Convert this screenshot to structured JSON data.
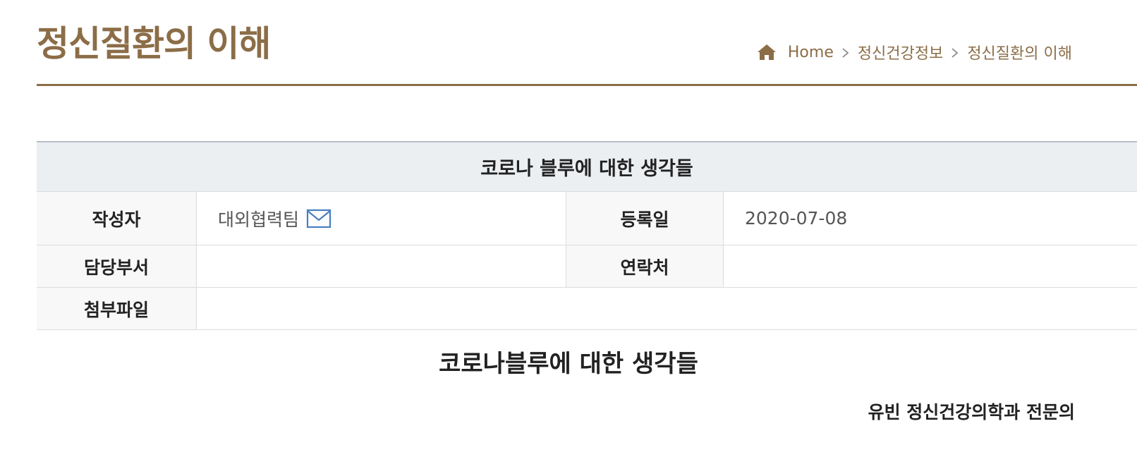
{
  "header": {
    "title": "정신질환의 이해",
    "breadcrumb": {
      "home": "Home",
      "level1": "정신건강정보",
      "level2": "정신질환의 이해"
    }
  },
  "post": {
    "subject": "코로나 블루에 대한 생각들",
    "fields": {
      "author_label": "작성자",
      "author_value": "대외협력팀",
      "date_label": "등록일",
      "date_value": "2020-07-08",
      "dept_label": "담당부서",
      "dept_value": "",
      "contact_label": "연락처",
      "contact_value": "",
      "attach_label": "첨부파일",
      "attach_value": ""
    },
    "content": {
      "heading": "코로나블루에 대한 생각들",
      "author_line": "유빈 정신건강의학과 전문의"
    }
  },
  "icons": {
    "home": "home-icon",
    "breadcrumb_separator": "chevron-right-icon",
    "mail": "mail-icon"
  },
  "colors": {
    "brand": "#8b6d47",
    "subject_bg": "#eceff2",
    "label_bg": "#f8f8f8",
    "mail_icon": "#4a7fc1"
  }
}
